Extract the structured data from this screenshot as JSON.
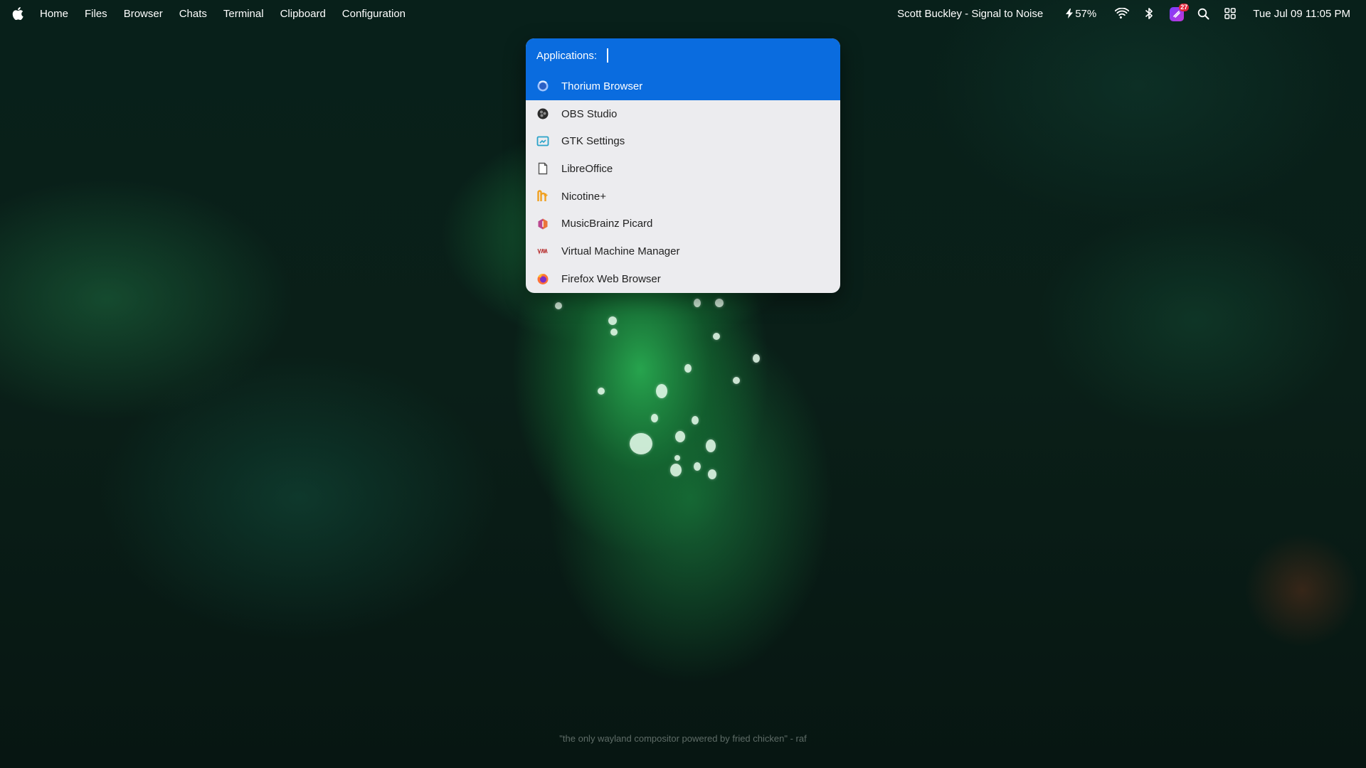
{
  "topbar": {
    "menu": [
      "Home",
      "Files",
      "Browser",
      "Chats",
      "Terminal",
      "Clipboard",
      "Configuration"
    ],
    "now_playing": "Scott Buckley - Signal to Noise",
    "battery": "57%",
    "notification_count": "27",
    "datetime": "Tue Jul 09 11:05 PM"
  },
  "launcher": {
    "prompt": "Applications:",
    "query": "",
    "selected_index": 0,
    "apps": [
      {
        "label": "Thorium Browser",
        "icon": "thorium-icon"
      },
      {
        "label": "OBS Studio",
        "icon": "obs-icon"
      },
      {
        "label": "GTK Settings",
        "icon": "gtk-settings-icon"
      },
      {
        "label": "LibreOffice",
        "icon": "libreoffice-icon"
      },
      {
        "label": "Nicotine+",
        "icon": "nicotine-icon"
      },
      {
        "label": "MusicBrainz Picard",
        "icon": "picard-icon"
      },
      {
        "label": "Virtual Machine Manager",
        "icon": "virt-manager-icon"
      },
      {
        "label": "Firefox Web Browser",
        "icon": "firefox-icon"
      }
    ]
  },
  "wallpaper": {
    "quote": "\"the only wayland compositor powered by fried chicken\" - raf"
  },
  "colors": {
    "accent": "#0a6cdf",
    "launcher_bg": "#ececef"
  }
}
